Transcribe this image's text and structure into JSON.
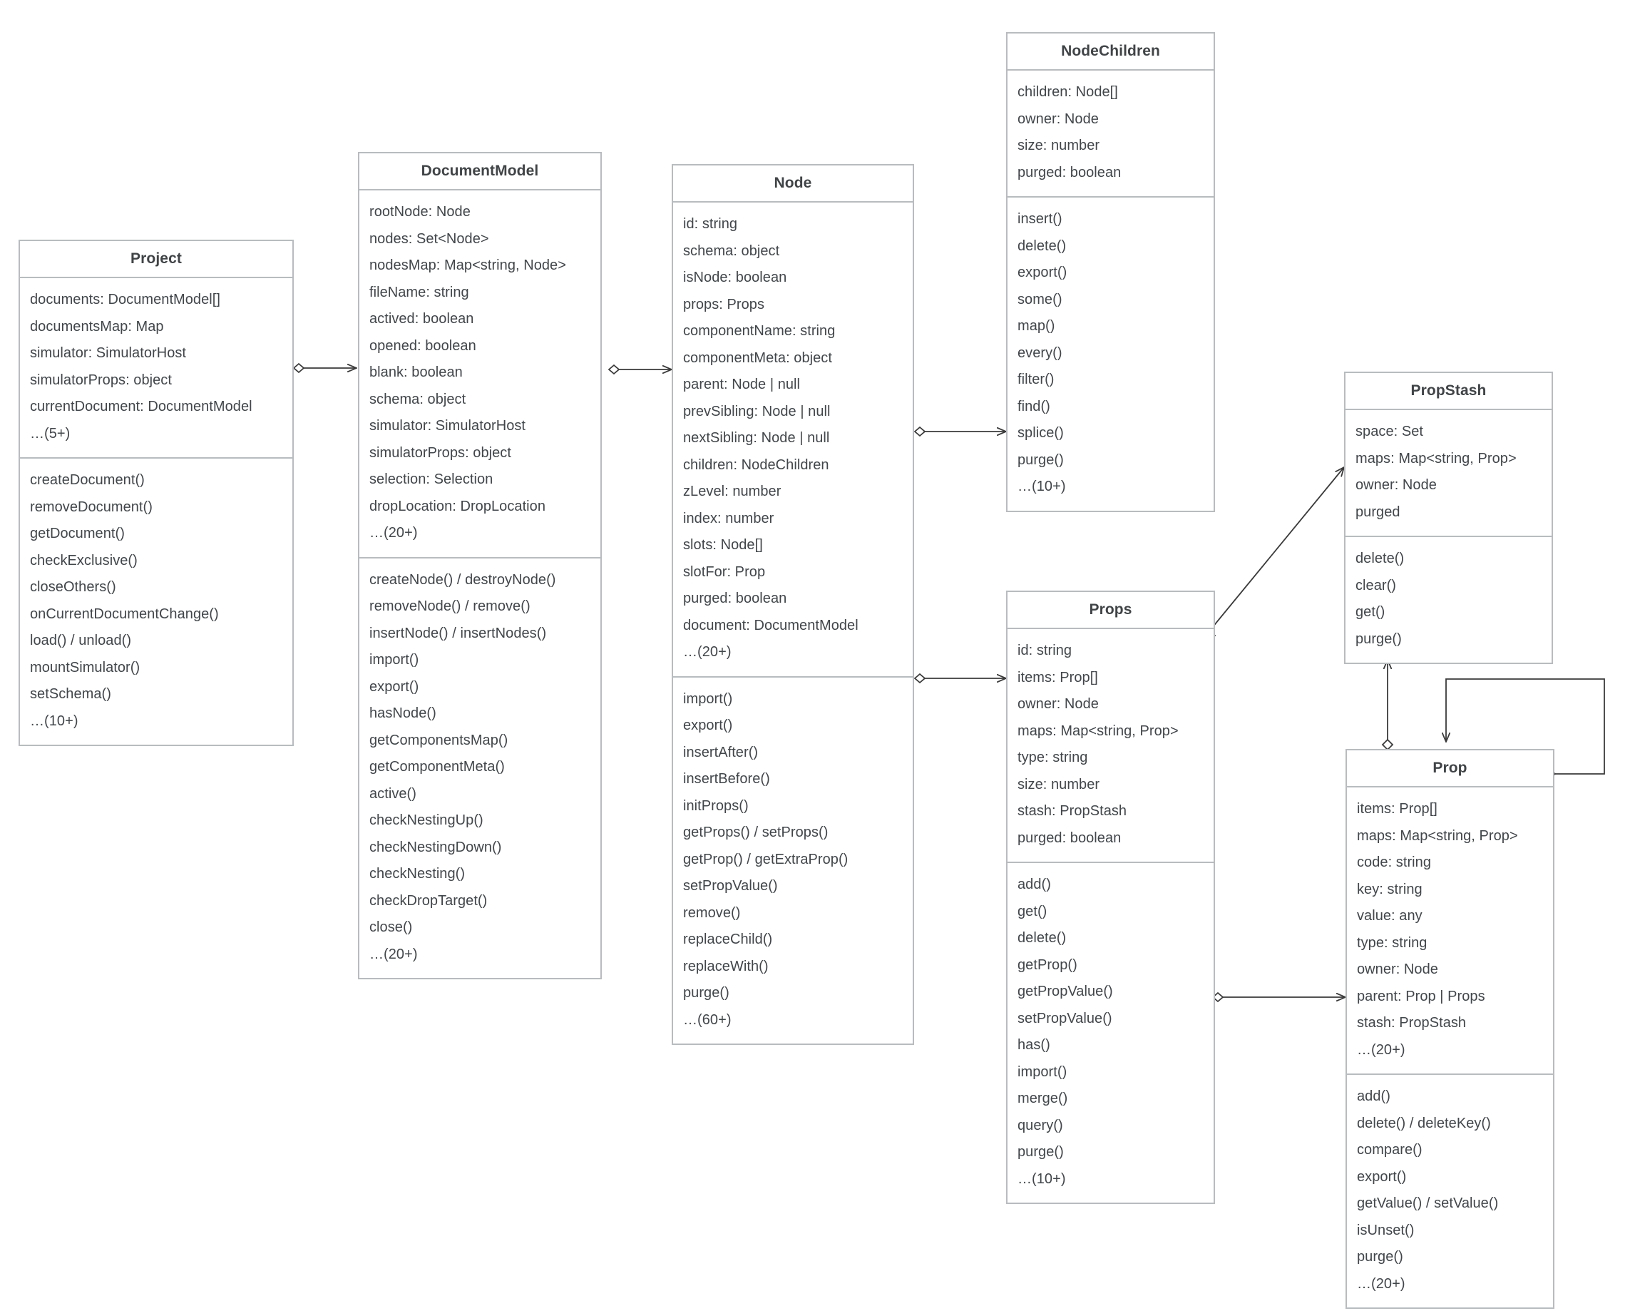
{
  "diagram": {
    "title": "UML class diagram",
    "type": "uml-class-diagram",
    "background_color": "#ffffff",
    "border_color": "#b8bcbf",
    "text_color": "#41464a",
    "line_color": "#3a3a3a"
  },
  "classes": [
    {
      "id": "project",
      "name": "Project",
      "attributes": [
        "documents: DocumentModel[]",
        "documentsMap: Map",
        "simulator: SimulatorHost",
        "simulatorProps: object",
        "currentDocument: DocumentModel",
        "…(5+)"
      ],
      "methods": [
        "createDocument()",
        "removeDocument()",
        "getDocument()",
        "checkExclusive()",
        "closeOthers()",
        "onCurrentDocumentChange()",
        "load() / unload()",
        "mountSimulator()",
        "setSchema()",
        "…(10+)"
      ]
    },
    {
      "id": "documentmodel",
      "name": "DocumentModel",
      "attributes": [
        "rootNode: Node",
        "nodes: Set<Node>",
        "nodesMap: Map<string, Node>",
        "fileName: string",
        "actived: boolean",
        "opened: boolean",
        "blank: boolean",
        "schema: object",
        "simulator: SimulatorHost",
        "simulatorProps: object",
        "selection: Selection",
        "dropLocation: DropLocation",
        "…(20+)"
      ],
      "methods": [
        "createNode() / destroyNode()",
        "removeNode() / remove()",
        "insertNode() / insertNodes()",
        "import()",
        "export()",
        "hasNode()",
        "getComponentsMap()",
        "getComponentMeta()",
        "active()",
        "checkNestingUp()",
        "checkNestingDown()",
        "checkNesting()",
        "checkDropTarget()",
        "close()",
        "…(20+)"
      ]
    },
    {
      "id": "node",
      "name": "Node",
      "attributes": [
        "id: string",
        "schema: object",
        "isNode: boolean",
        "props: Props",
        "componentName: string",
        "componentMeta: object",
        "parent: Node | null",
        "prevSibling: Node | null",
        "nextSibling: Node | null",
        "children: NodeChildren",
        "zLevel: number",
        "index: number",
        "slots: Node[]",
        "slotFor: Prop",
        "purged: boolean",
        "document: DocumentModel",
        "…(20+)"
      ],
      "methods": [
        "import()",
        "export()",
        "insertAfter()",
        "insertBefore()",
        "initProps()",
        "getProps() / setProps()",
        "getProp() / getExtraProp()",
        "setPropValue()",
        "remove()",
        "replaceChild()",
        "replaceWith()",
        "purge()",
        "…(60+)"
      ]
    },
    {
      "id": "nodechildren",
      "name": "NodeChildren",
      "attributes": [
        "children: Node[]",
        "owner: Node",
        "size: number",
        "purged: boolean"
      ],
      "methods": [
        "insert()",
        "delete()",
        "export()",
        "some()",
        "map()",
        "every()",
        "filter()",
        "find()",
        "splice()",
        "purge()",
        "…(10+)"
      ]
    },
    {
      "id": "props",
      "name": "Props",
      "attributes": [
        "id: string",
        "items: Prop[]",
        "owner: Node",
        "maps: Map<string, Prop>",
        "type: string",
        "size: number",
        "stash: PropStash",
        "purged: boolean"
      ],
      "methods": [
        "add()",
        "get()",
        "delete()",
        "getProp()",
        "getPropValue()",
        "setPropValue()",
        "has()",
        "import()",
        "merge()",
        "query()",
        "purge()",
        "…(10+)"
      ]
    },
    {
      "id": "propstash",
      "name": "PropStash",
      "attributes": [
        "space: Set",
        "maps: Map<string, Prop>",
        "owner: Node",
        "purged"
      ],
      "methods": [
        "delete()",
        "clear()",
        "get()",
        "purge()"
      ]
    },
    {
      "id": "prop",
      "name": "Prop",
      "attributes": [
        "items: Prop[]",
        "maps: Map<string, Prop>",
        "code: string",
        "key: string",
        "value: any",
        "type: string",
        "owner: Node",
        "parent: Prop | Props",
        "stash: PropStash",
        "…(20+)"
      ],
      "methods": [
        "add()",
        "delete() / deleteKey()",
        "compare()",
        "export()",
        "getValue() / setValue()",
        "isUnset()",
        "purge()",
        "…(20+)"
      ]
    }
  ],
  "relationships": [
    {
      "id": "rel-project-documentmodel",
      "from": "Project",
      "to": "DocumentModel",
      "kind": "aggregation"
    },
    {
      "id": "rel-documentmodel-node",
      "from": "DocumentModel",
      "to": "Node",
      "kind": "aggregation"
    },
    {
      "id": "rel-node-nodechildren",
      "from": "Node",
      "to": "NodeChildren",
      "kind": "aggregation"
    },
    {
      "id": "rel-node-props",
      "from": "Node",
      "to": "Props",
      "kind": "aggregation"
    },
    {
      "id": "rel-props-propstash",
      "from": "Props",
      "to": "PropStash",
      "kind": "aggregation"
    },
    {
      "id": "rel-props-prop",
      "from": "Props",
      "to": "Prop",
      "kind": "aggregation"
    },
    {
      "id": "rel-prop-propstash",
      "from": "Prop",
      "to": "PropStash",
      "kind": "aggregation"
    },
    {
      "id": "rel-prop-prop",
      "from": "Prop",
      "to": "Prop",
      "kind": "aggregation-self"
    }
  ]
}
